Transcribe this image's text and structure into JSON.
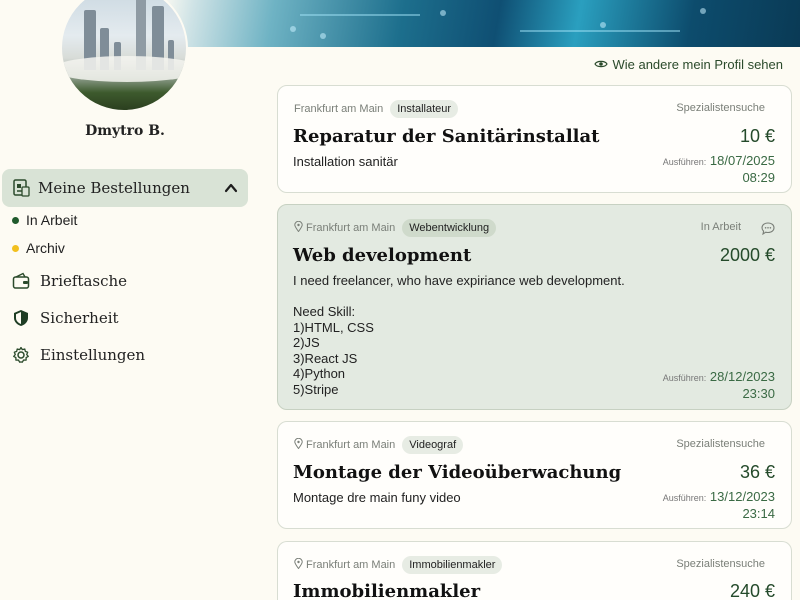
{
  "profile": {
    "name": "Dmytro B.",
    "view_profile_link": "Wie andere mein Profil sehen"
  },
  "sidebar": {
    "orders_label": "Meine Bestellungen",
    "sub_items": [
      {
        "label": "In Arbeit",
        "color": "#1f5a2c"
      },
      {
        "label": "Archiv",
        "color": "#f2c01e"
      }
    ],
    "items": [
      {
        "label": "Brieftasche",
        "icon": "wallet-icon"
      },
      {
        "label": "Sicherheit",
        "icon": "shield-icon"
      },
      {
        "label": "Einstellungen",
        "icon": "gear-icon"
      }
    ]
  },
  "orders": [
    {
      "city": "Frankfurt am Main",
      "category": "Installateur",
      "status": "Spezialistensuche",
      "title": "Reparatur der Sanitärinstallat",
      "price": "10 €",
      "description": "Installation sanitär",
      "due_label": "Ausführen:",
      "due_date": "18/07/2025",
      "due_time": "08:29"
    },
    {
      "city": "Frankfurt am Main",
      "category": "Webentwicklung",
      "status": "In Arbeit",
      "title": "Web development",
      "price": "2000 €",
      "description": "I need freelancer, who have expiriance web development.\n\nNeed Skill:\n1)HTML, CSS\n2)JS\n3)React JS\n4)Python\n5)Stripe",
      "due_label": "Ausführen:",
      "due_date": "28/12/2023",
      "due_time": "23:30"
    },
    {
      "city": "Frankfurt am Main",
      "category": "Videograf",
      "status": "Spezialistensuche",
      "title": "Montage der Videoüberwachung",
      "price": "36 €",
      "description": "Montage dre main funy video",
      "due_label": "Ausführen:",
      "due_date": "13/12/2023",
      "due_time": "23:14"
    },
    {
      "city": "Frankfurt am Main",
      "category": "Immobilienmakler",
      "status": "Spezialistensuche",
      "title": "Immobilienmakler",
      "price": "240 €"
    }
  ],
  "colors": {
    "accent_green": "#244a2a",
    "active_bg": "#d9e3d6",
    "page_bg": "#fdfbf3"
  }
}
